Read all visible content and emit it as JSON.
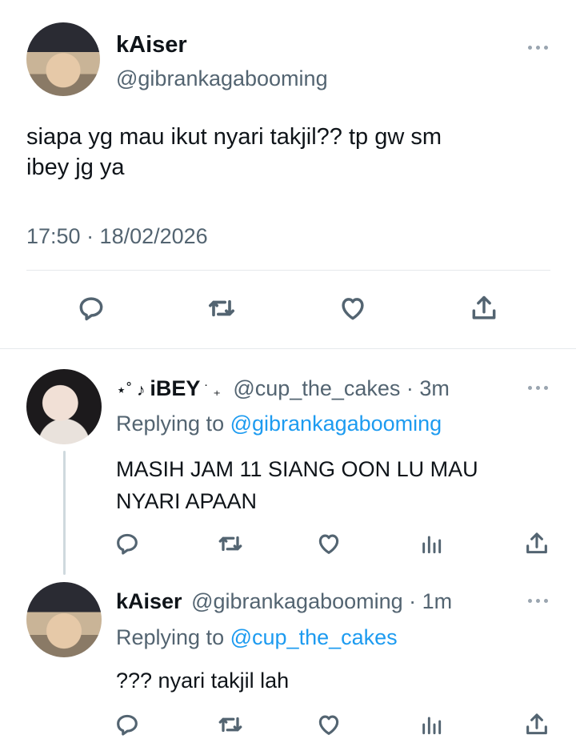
{
  "main_tweet": {
    "display_name": "kAiser",
    "handle": "@gibrankagabooming",
    "text_line1": "siapa yg mau ikut nyari takjil?? tp gw sm",
    "text_line2": "ibey jg ya",
    "timestamp": "17:50 · 18/02/2026"
  },
  "reply1": {
    "display_name_prefix": "⋆˚ ♪ ",
    "display_name_main": "iBEY",
    "display_name_suffix": " ˙ ₊",
    "handle_time": "@cup_the_cakes · 3m",
    "replying_to_label": "Replying to",
    "replying_to_handle": "@gibrankagabooming",
    "text_line1": "MASIH JAM 11 SIANG OON LU MAU",
    "text_line2": "NYARI APAAN"
  },
  "reply2": {
    "display_name": "kAiser",
    "handle_time": "@gibrankagabooming · 1m",
    "replying_to_label": "Replying to",
    "replying_to_handle": "@cup_the_cakes",
    "text": "??? nyari takjil lah"
  },
  "icons": [
    "reply-icon",
    "retweet-icon",
    "like-icon",
    "views-icon",
    "share-icon",
    "more-icon"
  ],
  "colors": {
    "link": "#1d9bf0",
    "secondary_text": "#536471",
    "icon": "#536471"
  }
}
